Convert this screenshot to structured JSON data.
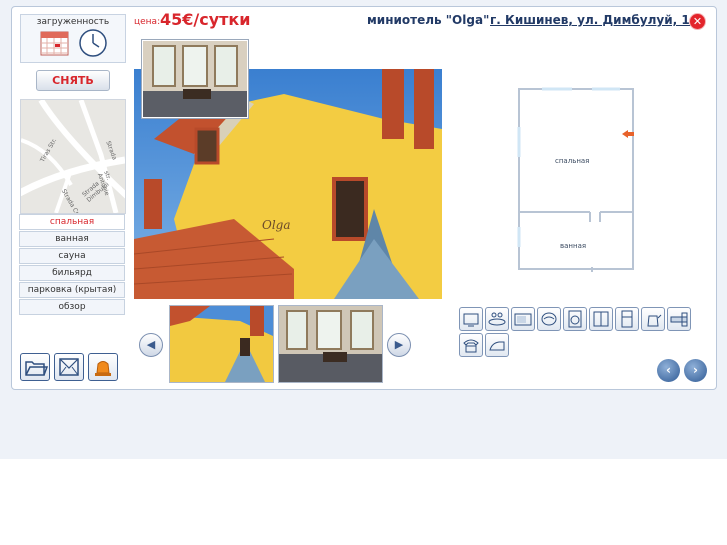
{
  "occupancy": {
    "label": "загруженность"
  },
  "book_button": {
    "label": "СНЯТЬ"
  },
  "map": {
    "labels": [
      "Strada Dimbului",
      "Tiras Str.",
      "Strada Crinilor",
      "Strada",
      "str. Antonie"
    ]
  },
  "menu": {
    "items": [
      {
        "label": "спальная",
        "active": true
      },
      {
        "label": "ванная",
        "active": false
      },
      {
        "label": "сауна",
        "active": false
      },
      {
        "label": "бильярд",
        "active": false
      },
      {
        "label": "парковка (крытая)",
        "active": false
      },
      {
        "label": "обзор",
        "active": false
      }
    ]
  },
  "header": {
    "price_prefix": "цена:",
    "price_value": "45€/сутки",
    "hotel_name": "миниотель \"Olga\"",
    "address": "г. Кишинев, ул. Димбулуй, 1/3",
    "close_symbol": "✕"
  },
  "photo": {
    "sign_text": "Olga"
  },
  "floor_plan": {
    "room_bedroom": "спальная",
    "room_bathroom": "ванная"
  },
  "amenities": [
    "tv-icon",
    "dishes-icon",
    "microwave-icon",
    "air-conditioner-icon",
    "washing-machine-icon",
    "coffee-maker-icon",
    "fridge-icon",
    "kettle-icon",
    "hairdryer-icon",
    "monitor-icon",
    "phone-icon",
    "iron-icon"
  ],
  "colors": {
    "accent_red": "#d8262c",
    "title_blue": "#223a66",
    "border": "#b9c7da"
  }
}
